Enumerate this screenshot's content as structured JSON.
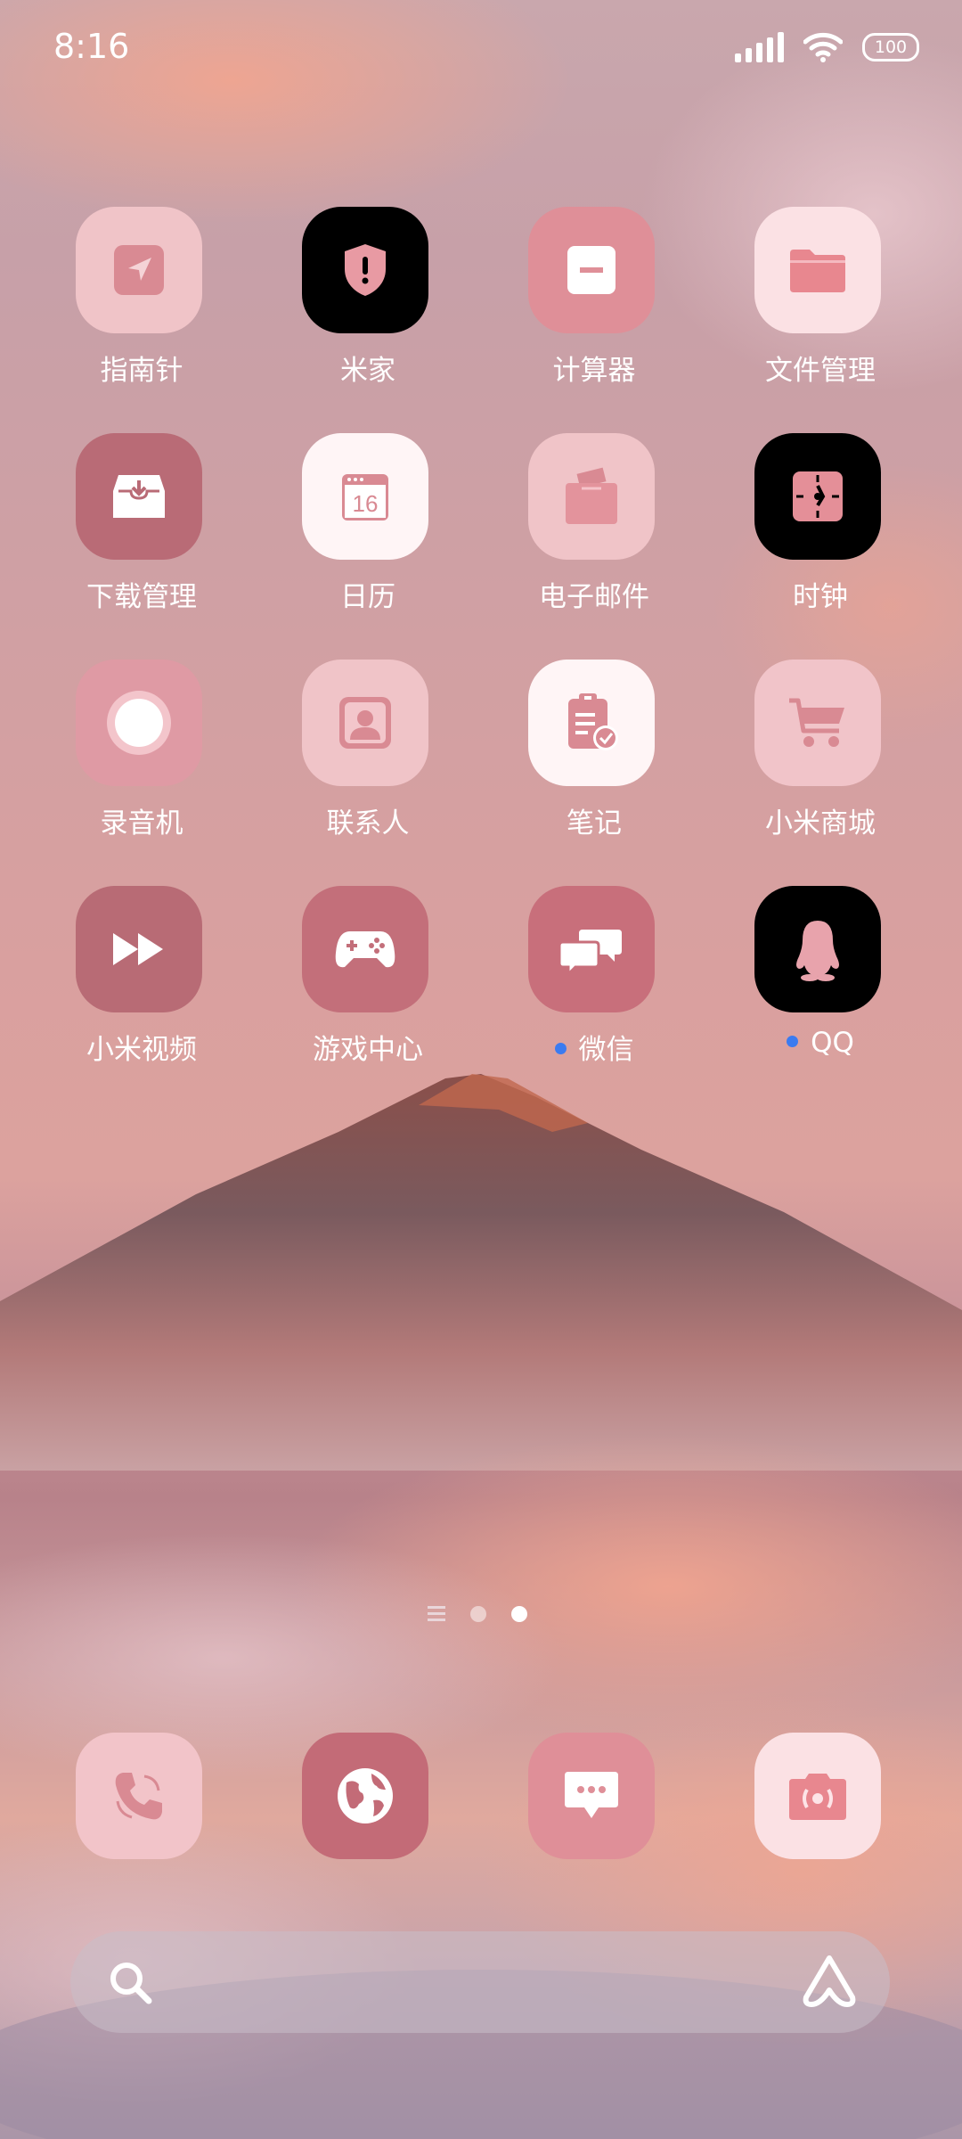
{
  "status_bar": {
    "time": "8:16",
    "battery": "100",
    "signal_icon": "signal-icon",
    "wifi_icon": "wifi-icon"
  },
  "apps": [
    {
      "label": "指南针",
      "icon": "compass-icon",
      "bg": "#f0c4c8"
    },
    {
      "label": "米家",
      "icon": "shield-alert-icon",
      "bg": "#000000"
    },
    {
      "label": "计算器",
      "icon": "calculator-icon",
      "bg": "#df8f98"
    },
    {
      "label": "文件管理",
      "icon": "folder-icon",
      "bg": "#fbe1e4"
    },
    {
      "label": "下载管理",
      "icon": "download-box-icon",
      "bg": "#b96b76"
    },
    {
      "label": "日历",
      "icon": "calendar-icon",
      "bg": "#fff5f6",
      "date": "16"
    },
    {
      "label": "电子邮件",
      "icon": "mail-bag-icon",
      "bg": "#f0c4c8"
    },
    {
      "label": "时钟",
      "icon": "clock-icon",
      "bg": "#000000"
    },
    {
      "label": "录音机",
      "icon": "recorder-icon",
      "bg": "#df9aa4"
    },
    {
      "label": "联系人",
      "icon": "contact-icon",
      "bg": "#f0c4c8"
    },
    {
      "label": "笔记",
      "icon": "notes-icon",
      "bg": "#fff5f6"
    },
    {
      "label": "小米商城",
      "icon": "cart-icon",
      "bg": "#f1c4c9"
    },
    {
      "label": "小米视频",
      "icon": "fast-forward-icon",
      "bg": "#b86b75"
    },
    {
      "label": "游戏中心",
      "icon": "gamepad-icon",
      "bg": "#c36f7a"
    },
    {
      "label": "微信",
      "icon": "chat-bubbles-icon",
      "bg": "#c86f7b",
      "new_dot": true
    },
    {
      "label": "QQ",
      "icon": "penguin-icon",
      "bg": "#000000",
      "new_dot": true
    }
  ],
  "dock": [
    {
      "icon": "phone-icon",
      "bg": "#f2c4c9"
    },
    {
      "icon": "globe-icon",
      "bg": "#c36b77"
    },
    {
      "icon": "message-icon",
      "bg": "#df8f98"
    },
    {
      "icon": "camera-icon",
      "bg": "#fbe1e4"
    }
  ],
  "page_indicator": {
    "pages": 2,
    "active": 2
  },
  "search_bar": {
    "search_icon": "search-icon",
    "assistant_icon": "assistant-icon"
  },
  "colors": {
    "accent_pink": "#d98a93",
    "dot_blue": "#3b7bf0"
  }
}
